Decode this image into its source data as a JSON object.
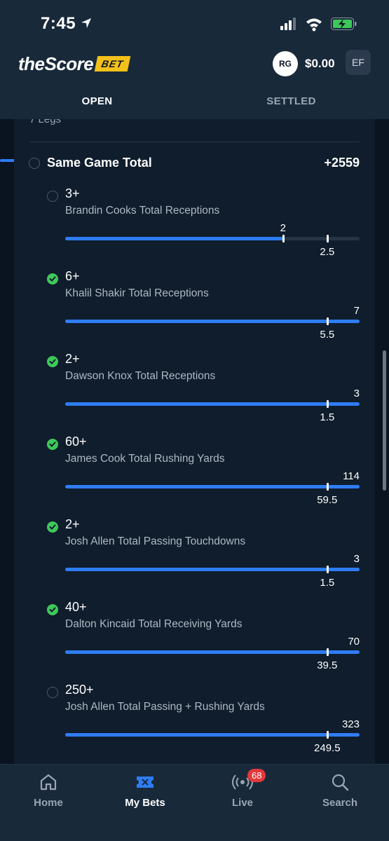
{
  "status_bar": {
    "time": "7:45"
  },
  "header": {
    "logo_text": "theScore",
    "logo_badge": "BET",
    "rg_badge": "RG",
    "balance": "$0.00",
    "avatar_initials": "EF"
  },
  "tabs": [
    {
      "label": "OPEN",
      "active": true
    },
    {
      "label": "SETTLED",
      "active": false
    }
  ],
  "bet": {
    "legs_peek": "7 Legs",
    "title": "Same Game Total",
    "odds": "+2559",
    "legs": [
      {
        "line": "3+",
        "desc": "Brandin Cooks Total Receptions",
        "status": "pending",
        "current": "2",
        "target": "2.5",
        "progress": 0.74,
        "target_pos": 0.89
      },
      {
        "line": "6+",
        "desc": "Khalil Shakir Total Receptions",
        "status": "won",
        "current": "7",
        "target": "5.5",
        "progress": 1.0,
        "target_pos": 0.89
      },
      {
        "line": "2+",
        "desc": "Dawson Knox Total Receptions",
        "status": "won",
        "current": "3",
        "target": "1.5",
        "progress": 1.0,
        "target_pos": 0.89
      },
      {
        "line": "60+",
        "desc": "James Cook Total Rushing Yards",
        "status": "won",
        "current": "114",
        "target": "59.5",
        "progress": 1.0,
        "target_pos": 0.89
      },
      {
        "line": "2+",
        "desc": "Josh Allen Total Passing Touchdowns",
        "status": "won",
        "current": "3",
        "target": "1.5",
        "progress": 1.0,
        "target_pos": 0.89
      },
      {
        "line": "40+",
        "desc": "Dalton Kincaid Total Receiving Yards",
        "status": "won",
        "current": "70",
        "target": "39.5",
        "progress": 1.0,
        "target_pos": 0.89
      },
      {
        "line": "250+",
        "desc": "Josh Allen Total Passing + Rushing Yards",
        "status": "pending",
        "current": "323",
        "target": "249.5",
        "progress": 1.0,
        "target_pos": 0.89
      }
    ]
  },
  "bottom_nav": [
    {
      "label": "Home",
      "icon": "home-icon",
      "active": false
    },
    {
      "label": "My Bets",
      "icon": "ticket-icon",
      "active": true
    },
    {
      "label": "Live",
      "icon": "broadcast-icon",
      "active": false,
      "badge": "68"
    },
    {
      "label": "Search",
      "icon": "search-icon",
      "active": false
    }
  ],
  "colors": {
    "accent": "#2f7df6",
    "won": "#3ec85a",
    "badge": "#e5383b",
    "brand_yellow": "#f4c11a"
  }
}
